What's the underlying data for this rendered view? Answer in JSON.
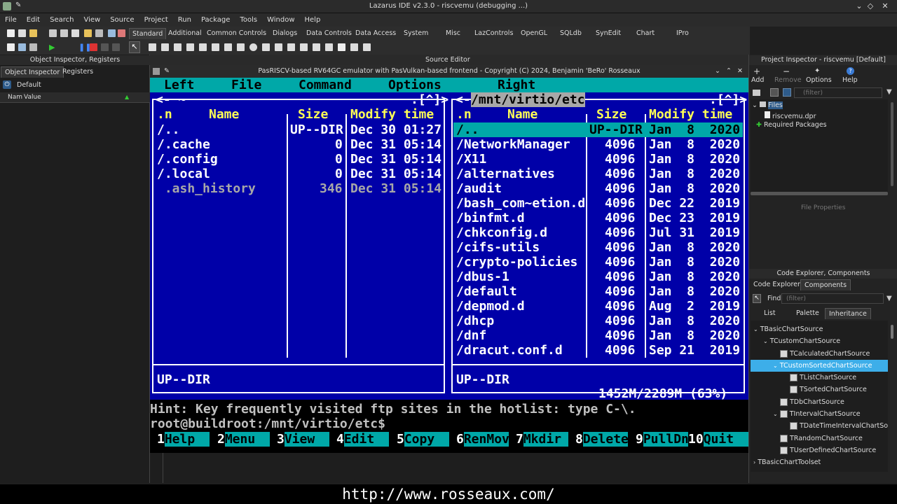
{
  "app_title": "Lazarus IDE v2.3.0 - riscvemu (debugging ...)",
  "menu": [
    "File",
    "Edit",
    "Search",
    "View",
    "Source",
    "Project",
    "Run",
    "Package",
    "Tools",
    "Window",
    "Help"
  ],
  "palette_tabs": [
    "Standard",
    "Additional",
    "Common Controls",
    "Dialogs",
    "Data Controls",
    "Data Access",
    "System",
    "Misc",
    "LazControls",
    "OpenGL",
    "SQLdb",
    "SynEdit",
    "Chart",
    "IPro"
  ],
  "left_panel": {
    "header": "Object Inspector, Registers",
    "tabs": [
      "Object Inspector",
      "Registers"
    ],
    "combo": "Default",
    "col_name": "Nam",
    "col_value": "Value"
  },
  "source_editor_label": "Source Editor",
  "emu_window_title": "PasRISCV-based RV64GC emulator with PasVulkan-based frontend - Copyright (C) 2024, Benjamin 'BeRo' Rosseaux",
  "mc": {
    "menu": [
      "Left",
      "File",
      "Command",
      "Options",
      "Right"
    ],
    "left_panel_path": "~",
    "right_panel_path": "/mnt/virtio/etc",
    "headers": {
      "n": ".n",
      "name": "Name",
      "size": "Size",
      "mtime": "Modify time"
    },
    "left_rows": [
      {
        "name": "/..",
        "size": "UP--DIR",
        "mtime": "Dec 30 01:27"
      },
      {
        "name": "/.cache",
        "size": "0",
        "mtime": "Dec 31 05:14"
      },
      {
        "name": "/.config",
        "size": "0",
        "mtime": "Dec 31 05:14"
      },
      {
        "name": "/.local",
        "size": "0",
        "mtime": "Dec 31 05:14"
      },
      {
        "name": " .ash_history",
        "size": "346",
        "mtime": "Dec 31 05:14"
      }
    ],
    "right_rows": [
      {
        "name": "/..",
        "size": "UP--DIR",
        "mtime": "Jan  8  2020"
      },
      {
        "name": "/NetworkManager",
        "size": "4096",
        "mtime": "Jan  8  2020"
      },
      {
        "name": "/X11",
        "size": "4096",
        "mtime": "Jan  8  2020"
      },
      {
        "name": "/alternatives",
        "size": "4096",
        "mtime": "Jan  8  2020"
      },
      {
        "name": "/audit",
        "size": "4096",
        "mtime": "Jan  8  2020"
      },
      {
        "name": "/bash_com~etion.d",
        "size": "4096",
        "mtime": "Dec 22  2019"
      },
      {
        "name": "/binfmt.d",
        "size": "4096",
        "mtime": "Dec 23  2019"
      },
      {
        "name": "/chkconfig.d",
        "size": "4096",
        "mtime": "Jul 31  2019"
      },
      {
        "name": "/cifs-utils",
        "size": "4096",
        "mtime": "Jan  8  2020"
      },
      {
        "name": "/crypto-policies",
        "size": "4096",
        "mtime": "Jan  8  2020"
      },
      {
        "name": "/dbus-1",
        "size": "4096",
        "mtime": "Jan  8  2020"
      },
      {
        "name": "/default",
        "size": "4096",
        "mtime": "Jan  8  2020"
      },
      {
        "name": "/depmod.d",
        "size": "4096",
        "mtime": "Aug  2  2019"
      },
      {
        "name": "/dhcp",
        "size": "4096",
        "mtime": "Jan  8  2020"
      },
      {
        "name": "/dnf",
        "size": "4096",
        "mtime": "Jan  8  2020"
      },
      {
        "name": "/dracut.conf.d",
        "size": "4096",
        "mtime": "Sep 21  2019"
      }
    ],
    "left_status": "UP--DIR",
    "right_status": "UP--DIR",
    "disk_free": "1452M/2289M (63%)",
    "hint": "Hint: Key frequently visited ftp sites in the hotlist: type C-\\.",
    "prompt": "root@buildroot:/mnt/virtio/etc$",
    "fkeys": [
      [
        "1",
        "Help"
      ],
      [
        "2",
        "Menu"
      ],
      [
        "3",
        "View"
      ],
      [
        "4",
        "Edit"
      ],
      [
        "5",
        "Copy"
      ],
      [
        "6",
        "RenMov"
      ],
      [
        "7",
        "Mkdir"
      ],
      [
        "8",
        "Delete"
      ],
      [
        "9",
        "PullDn"
      ],
      [
        "10",
        "Quit"
      ]
    ]
  },
  "project_inspector": {
    "header": "Project Inspector - riscvemu [Default]",
    "buttons": [
      "Add",
      "Remove",
      "Options",
      "Help"
    ],
    "filter_placeholder": "(filter)",
    "tree": [
      "Files",
      "riscvemu.dpr",
      "Required Packages"
    ],
    "file_properties": "File Properties"
  },
  "code_explorer": {
    "header": "Code Explorer, Components",
    "tabs": [
      "Code Explorer",
      "Components"
    ],
    "find_label": "Find",
    "filter_placeholder": "(filter)",
    "subtabs": [
      "List",
      "Palette",
      "Inheritance"
    ],
    "tree": [
      "TBasicChartSource",
      "TCustomChartSource",
      "TCalculatedChartSource",
      "TCustomSortedChartSource",
      "TListChartSource",
      "TSortedChartSource",
      "TDbChartSource",
      "TIntervalChartSource",
      "TDateTimeIntervalChartSo",
      "TRandomChartSource",
      "TUserDefinedChartSource",
      "TBasicChartToolset"
    ]
  },
  "url": "http://www.rosseaux.com/"
}
